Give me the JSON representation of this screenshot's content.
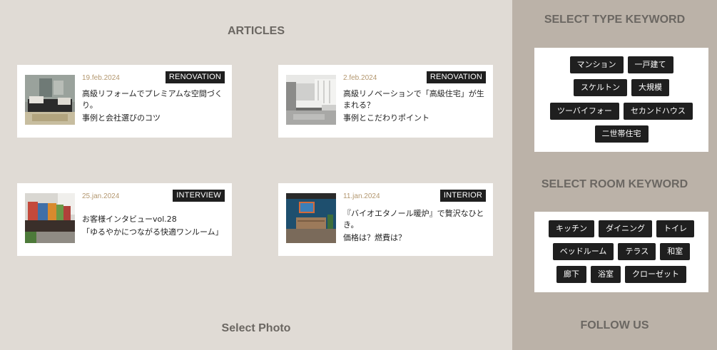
{
  "articles": {
    "title": "ARTICLES",
    "items": [
      {
        "date": "19.feb.2024",
        "category": "RENOVATION",
        "line1": "高級リフォームでプレミアムな空間づくり。",
        "line2": "事例と会社選びのコツ",
        "image": "living-room-photo"
      },
      {
        "date": "2.feb.2024",
        "category": "RENOVATION",
        "line1": "高級リノベーションで「高級住宅」が生まれる？",
        "line2": "事例とこだわりポイント",
        "image": "bedroom-photo"
      },
      {
        "date": "25.jan.2024",
        "category": "INTERVIEW",
        "line1": "お客様インタビューvol.28",
        "line2": "「ゆるやかにつながる快適ワンルーム」",
        "image": "sofa-room-photo"
      },
      {
        "date": "11.jan.2024",
        "category": "INTERIOR",
        "line1": "『バイオエタノール暖炉』で贅沢なひとき。",
        "line2": "価格は？燃費は？",
        "image": "blue-wall-room-photo"
      }
    ]
  },
  "select_photo": {
    "label": "Select Photo"
  },
  "sidebar": {
    "type_title": "SELECT TYPE KEYWORD",
    "type_rows": [
      [
        "マンション",
        "一戸建て"
      ],
      [
        "スケルトン",
        "大規模"
      ],
      [
        "ツーバイフォー",
        "セカンドハウス"
      ],
      [
        "二世帯住宅"
      ]
    ],
    "room_title": "SELECT ROOM KEYWORD",
    "room_rows": [
      [
        "キッチン",
        "ダイニング",
        "トイレ"
      ],
      [
        "ベッドルーム",
        "テラス",
        "和室"
      ],
      [
        "廊下",
        "浴室",
        "クローゼット"
      ]
    ],
    "follow_title": "FOLLOW US"
  }
}
